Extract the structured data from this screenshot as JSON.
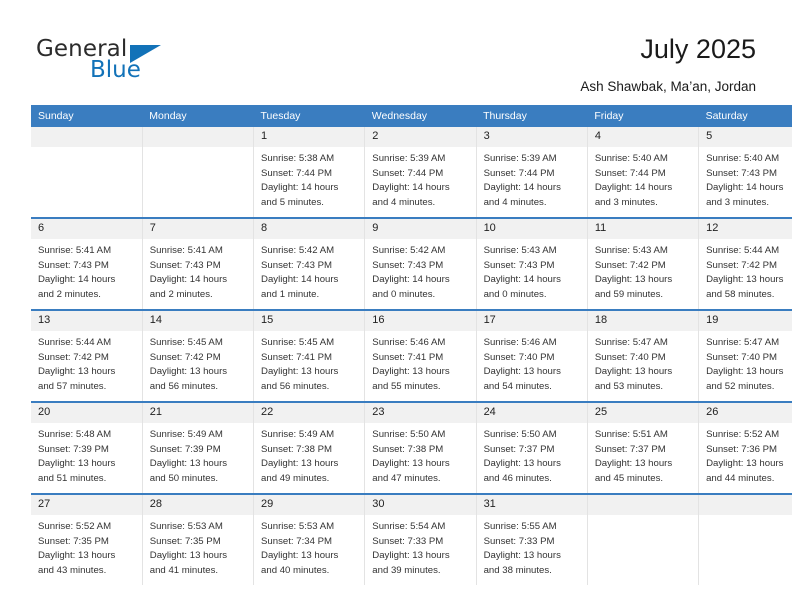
{
  "brand": {
    "word_one": "General",
    "word_two": "Blue",
    "accent_color": "#1272b8"
  },
  "header": {
    "title": "July 2025",
    "subtitle": "Ash Shawbak, Ma’an, Jordan"
  },
  "calendar": {
    "header_bg": "#3a7dc0",
    "daynum_bg": "#f1f1f1",
    "weekday_names": [
      "Sunday",
      "Monday",
      "Tuesday",
      "Wednesday",
      "Thursday",
      "Friday",
      "Saturday"
    ],
    "weeks": [
      [
        {
          "day": "",
          "lines": []
        },
        {
          "day": "",
          "lines": []
        },
        {
          "day": "1",
          "lines": [
            "Sunrise: 5:38 AM",
            "Sunset: 7:44 PM",
            "Daylight: 14 hours",
            "and 5 minutes."
          ]
        },
        {
          "day": "2",
          "lines": [
            "Sunrise: 5:39 AM",
            "Sunset: 7:44 PM",
            "Daylight: 14 hours",
            "and 4 minutes."
          ]
        },
        {
          "day": "3",
          "lines": [
            "Sunrise: 5:39 AM",
            "Sunset: 7:44 PM",
            "Daylight: 14 hours",
            "and 4 minutes."
          ]
        },
        {
          "day": "4",
          "lines": [
            "Sunrise: 5:40 AM",
            "Sunset: 7:44 PM",
            "Daylight: 14 hours",
            "and 3 minutes."
          ]
        },
        {
          "day": "5",
          "lines": [
            "Sunrise: 5:40 AM",
            "Sunset: 7:43 PM",
            "Daylight: 14 hours",
            "and 3 minutes."
          ]
        }
      ],
      [
        {
          "day": "6",
          "lines": [
            "Sunrise: 5:41 AM",
            "Sunset: 7:43 PM",
            "Daylight: 14 hours",
            "and 2 minutes."
          ]
        },
        {
          "day": "7",
          "lines": [
            "Sunrise: 5:41 AM",
            "Sunset: 7:43 PM",
            "Daylight: 14 hours",
            "and 2 minutes."
          ]
        },
        {
          "day": "8",
          "lines": [
            "Sunrise: 5:42 AM",
            "Sunset: 7:43 PM",
            "Daylight: 14 hours",
            "and 1 minute."
          ]
        },
        {
          "day": "9",
          "lines": [
            "Sunrise: 5:42 AM",
            "Sunset: 7:43 PM",
            "Daylight: 14 hours",
            "and 0 minutes."
          ]
        },
        {
          "day": "10",
          "lines": [
            "Sunrise: 5:43 AM",
            "Sunset: 7:43 PM",
            "Daylight: 14 hours",
            "and 0 minutes."
          ]
        },
        {
          "day": "11",
          "lines": [
            "Sunrise: 5:43 AM",
            "Sunset: 7:42 PM",
            "Daylight: 13 hours",
            "and 59 minutes."
          ]
        },
        {
          "day": "12",
          "lines": [
            "Sunrise: 5:44 AM",
            "Sunset: 7:42 PM",
            "Daylight: 13 hours",
            "and 58 minutes."
          ]
        }
      ],
      [
        {
          "day": "13",
          "lines": [
            "Sunrise: 5:44 AM",
            "Sunset: 7:42 PM",
            "Daylight: 13 hours",
            "and 57 minutes."
          ]
        },
        {
          "day": "14",
          "lines": [
            "Sunrise: 5:45 AM",
            "Sunset: 7:42 PM",
            "Daylight: 13 hours",
            "and 56 minutes."
          ]
        },
        {
          "day": "15",
          "lines": [
            "Sunrise: 5:45 AM",
            "Sunset: 7:41 PM",
            "Daylight: 13 hours",
            "and 56 minutes."
          ]
        },
        {
          "day": "16",
          "lines": [
            "Sunrise: 5:46 AM",
            "Sunset: 7:41 PM",
            "Daylight: 13 hours",
            "and 55 minutes."
          ]
        },
        {
          "day": "17",
          "lines": [
            "Sunrise: 5:46 AM",
            "Sunset: 7:40 PM",
            "Daylight: 13 hours",
            "and 54 minutes."
          ]
        },
        {
          "day": "18",
          "lines": [
            "Sunrise: 5:47 AM",
            "Sunset: 7:40 PM",
            "Daylight: 13 hours",
            "and 53 minutes."
          ]
        },
        {
          "day": "19",
          "lines": [
            "Sunrise: 5:47 AM",
            "Sunset: 7:40 PM",
            "Daylight: 13 hours",
            "and 52 minutes."
          ]
        }
      ],
      [
        {
          "day": "20",
          "lines": [
            "Sunrise: 5:48 AM",
            "Sunset: 7:39 PM",
            "Daylight: 13 hours",
            "and 51 minutes."
          ]
        },
        {
          "day": "21",
          "lines": [
            "Sunrise: 5:49 AM",
            "Sunset: 7:39 PM",
            "Daylight: 13 hours",
            "and 50 minutes."
          ]
        },
        {
          "day": "22",
          "lines": [
            "Sunrise: 5:49 AM",
            "Sunset: 7:38 PM",
            "Daylight: 13 hours",
            "and 49 minutes."
          ]
        },
        {
          "day": "23",
          "lines": [
            "Sunrise: 5:50 AM",
            "Sunset: 7:38 PM",
            "Daylight: 13 hours",
            "and 47 minutes."
          ]
        },
        {
          "day": "24",
          "lines": [
            "Sunrise: 5:50 AM",
            "Sunset: 7:37 PM",
            "Daylight: 13 hours",
            "and 46 minutes."
          ]
        },
        {
          "day": "25",
          "lines": [
            "Sunrise: 5:51 AM",
            "Sunset: 7:37 PM",
            "Daylight: 13 hours",
            "and 45 minutes."
          ]
        },
        {
          "day": "26",
          "lines": [
            "Sunrise: 5:52 AM",
            "Sunset: 7:36 PM",
            "Daylight: 13 hours",
            "and 44 minutes."
          ]
        }
      ],
      [
        {
          "day": "27",
          "lines": [
            "Sunrise: 5:52 AM",
            "Sunset: 7:35 PM",
            "Daylight: 13 hours",
            "and 43 minutes."
          ]
        },
        {
          "day": "28",
          "lines": [
            "Sunrise: 5:53 AM",
            "Sunset: 7:35 PM",
            "Daylight: 13 hours",
            "and 41 minutes."
          ]
        },
        {
          "day": "29",
          "lines": [
            "Sunrise: 5:53 AM",
            "Sunset: 7:34 PM",
            "Daylight: 13 hours",
            "and 40 minutes."
          ]
        },
        {
          "day": "30",
          "lines": [
            "Sunrise: 5:54 AM",
            "Sunset: 7:33 PM",
            "Daylight: 13 hours",
            "and 39 minutes."
          ]
        },
        {
          "day": "31",
          "lines": [
            "Sunrise: 5:55 AM",
            "Sunset: 7:33 PM",
            "Daylight: 13 hours",
            "and 38 minutes."
          ]
        },
        {
          "day": "",
          "lines": []
        },
        {
          "day": "",
          "lines": []
        }
      ]
    ]
  }
}
